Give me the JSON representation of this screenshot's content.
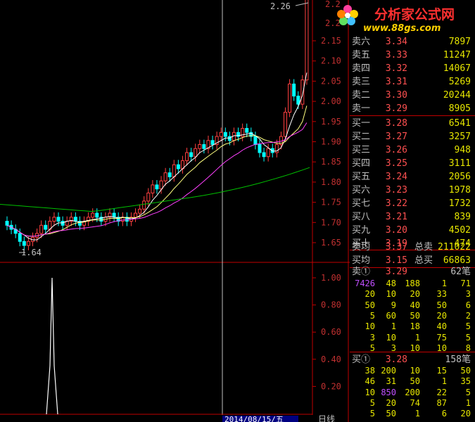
{
  "logo": {
    "name": "分析家公式网",
    "url": "www.88gs.com"
  },
  "main_chart": {
    "y_ticks": [
      "2.15",
      "2.10",
      "2.05",
      "2.00",
      "1.95",
      "1.90",
      "1.85",
      "1.80",
      "1.75",
      "1.70",
      "1.65"
    ],
    "top_ticks": [
      "2.2",
      "2.2"
    ],
    "high_label": "2.26",
    "low_label": "1.64",
    "date_label": "2014/08/15/五",
    "period_label": "日线"
  },
  "sub_chart": {
    "y_ticks": [
      "1.00",
      "0.80",
      "0.60",
      "0.40",
      "0.20"
    ]
  },
  "sell_orders": [
    {
      "label": "卖六",
      "price": "3.34",
      "volume": "7897"
    },
    {
      "label": "卖五",
      "price": "3.33",
      "volume": "11247"
    },
    {
      "label": "卖四",
      "price": "3.32",
      "volume": "14067"
    },
    {
      "label": "卖三",
      "price": "3.31",
      "volume": "5269"
    },
    {
      "label": "卖二",
      "price": "3.30",
      "volume": "20244"
    },
    {
      "label": "卖一",
      "price": "3.29",
      "volume": "8905"
    }
  ],
  "buy_orders": [
    {
      "label": "买一",
      "price": "3.28",
      "volume": "6541"
    },
    {
      "label": "买二",
      "price": "3.27",
      "volume": "3257"
    },
    {
      "label": "买三",
      "price": "3.26",
      "volume": "948"
    },
    {
      "label": "买四",
      "price": "3.25",
      "volume": "3111"
    },
    {
      "label": "买五",
      "price": "3.24",
      "volume": "2056"
    },
    {
      "label": "买六",
      "price": "3.23",
      "volume": "1978"
    },
    {
      "label": "买七",
      "price": "3.22",
      "volume": "1732"
    },
    {
      "label": "买八",
      "price": "3.21",
      "volume": "839"
    },
    {
      "label": "买九",
      "price": "3.20",
      "volume": "4502"
    },
    {
      "label": "买十",
      "price": "3.19",
      "volume": "474"
    }
  ],
  "averages": {
    "sell_avg_label": "卖均",
    "sell_avg": "3.37",
    "total_sell_label": "总卖",
    "total_sell": "211022",
    "buy_avg_label": "买均",
    "buy_avg": "3.15",
    "total_buy_label": "总买",
    "total_buy": "66863"
  },
  "sell_queue": {
    "label": "卖①",
    "price": "3.29",
    "count": "62笔",
    "rows": [
      [
        "7426",
        "48",
        "188",
        "1",
        "71"
      ],
      [
        "20",
        "10",
        "20",
        "33",
        "3"
      ],
      [
        "50",
        "9",
        "40",
        "50",
        "6"
      ],
      [
        "5",
        "60",
        "50",
        "20",
        "2"
      ],
      [
        "10",
        "1",
        "18",
        "40",
        "5"
      ],
      [
        "3",
        "10",
        "1",
        "75",
        "5"
      ],
      [
        "5",
        "3",
        "10",
        "10",
        "8"
      ]
    ]
  },
  "buy_queue": {
    "label": "买①",
    "price": "3.28",
    "count": "158笔",
    "rows": [
      [
        "38",
        "200",
        "10",
        "15",
        "50"
      ],
      [
        "46",
        "31",
        "50",
        "1",
        "35"
      ],
      [
        "10",
        "850",
        "200",
        "22",
        "5"
      ],
      [
        "5",
        "20",
        "74",
        "87",
        "1"
      ],
      [
        "5",
        "50",
        "1",
        "6",
        "20"
      ]
    ]
  },
  "colors": {
    "up": "#ff4040",
    "down": "#00ffff",
    "ma5": "#ffffff",
    "ma10": "#ffff80",
    "ma20": "#ff40ff",
    "ma60": "#00ff00",
    "axis": "#c00000",
    "price_red": "#ff5050",
    "volume_yellow": "#e6e600"
  }
}
